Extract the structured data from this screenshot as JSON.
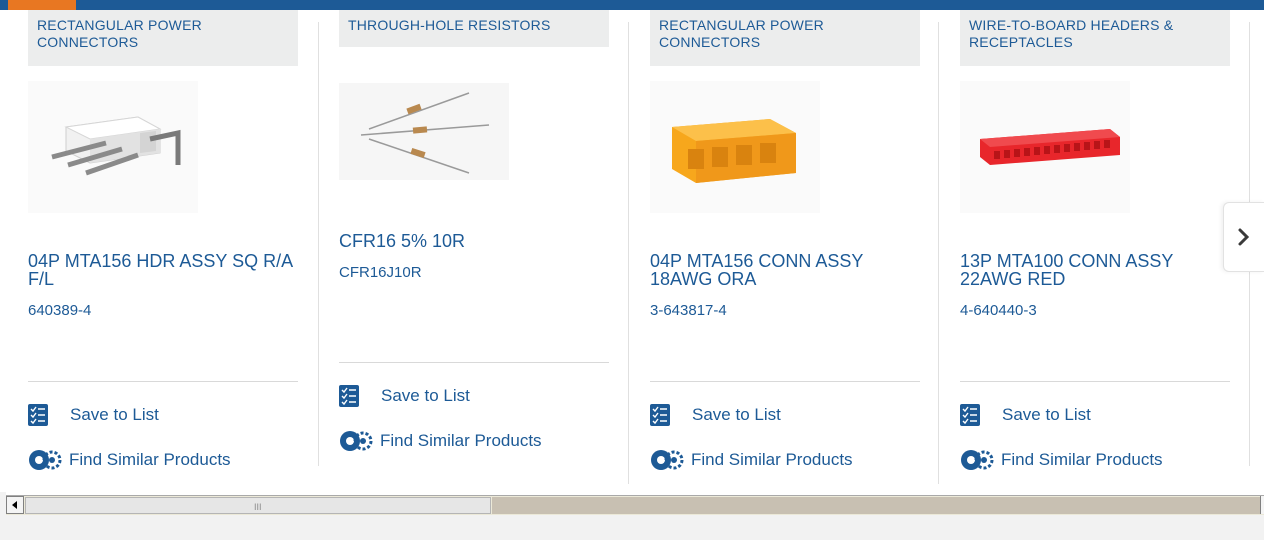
{
  "accent_colors": {
    "brand_blue": "#1d5a96",
    "accent_orange": "#e87722"
  },
  "carousel": {
    "cards": [
      {
        "category": "RECTANGULAR POWER CONNECTORS",
        "image": "white-right-angle-header-photo",
        "title": "04P MTA156 HDR ASSY SQ R/A F/L",
        "part_number": "640389-4",
        "save_label": "Save to List",
        "similar_label": "Find Similar Products"
      },
      {
        "category": "THROUGH-HOLE RESISTORS",
        "image": "through-hole-resistors-photo",
        "title": "CFR16 5% 10R",
        "part_number": "CFR16J10R",
        "save_label": "Save to List",
        "similar_label": "Find Similar Products"
      },
      {
        "category": "RECTANGULAR POWER CONNECTORS",
        "image": "yellow-connector-housing-photo",
        "title": "04P MTA156 CONN ASSY 18AWG ORA",
        "part_number": "3-643817-4",
        "save_label": "Save to List",
        "similar_label": "Find Similar Products"
      },
      {
        "category": "WIRE-TO-BOARD HEADERS & RECEPTACLES",
        "image": "red-receptacle-photo",
        "title": "13P MTA100 CONN ASSY 22AWG RED",
        "part_number": "4-640440-3",
        "save_label": "Save to List",
        "similar_label": "Find Similar Products"
      }
    ],
    "next_icon": "chevron-right-icon"
  },
  "scrollbar": {
    "grip_glyph": "III"
  }
}
